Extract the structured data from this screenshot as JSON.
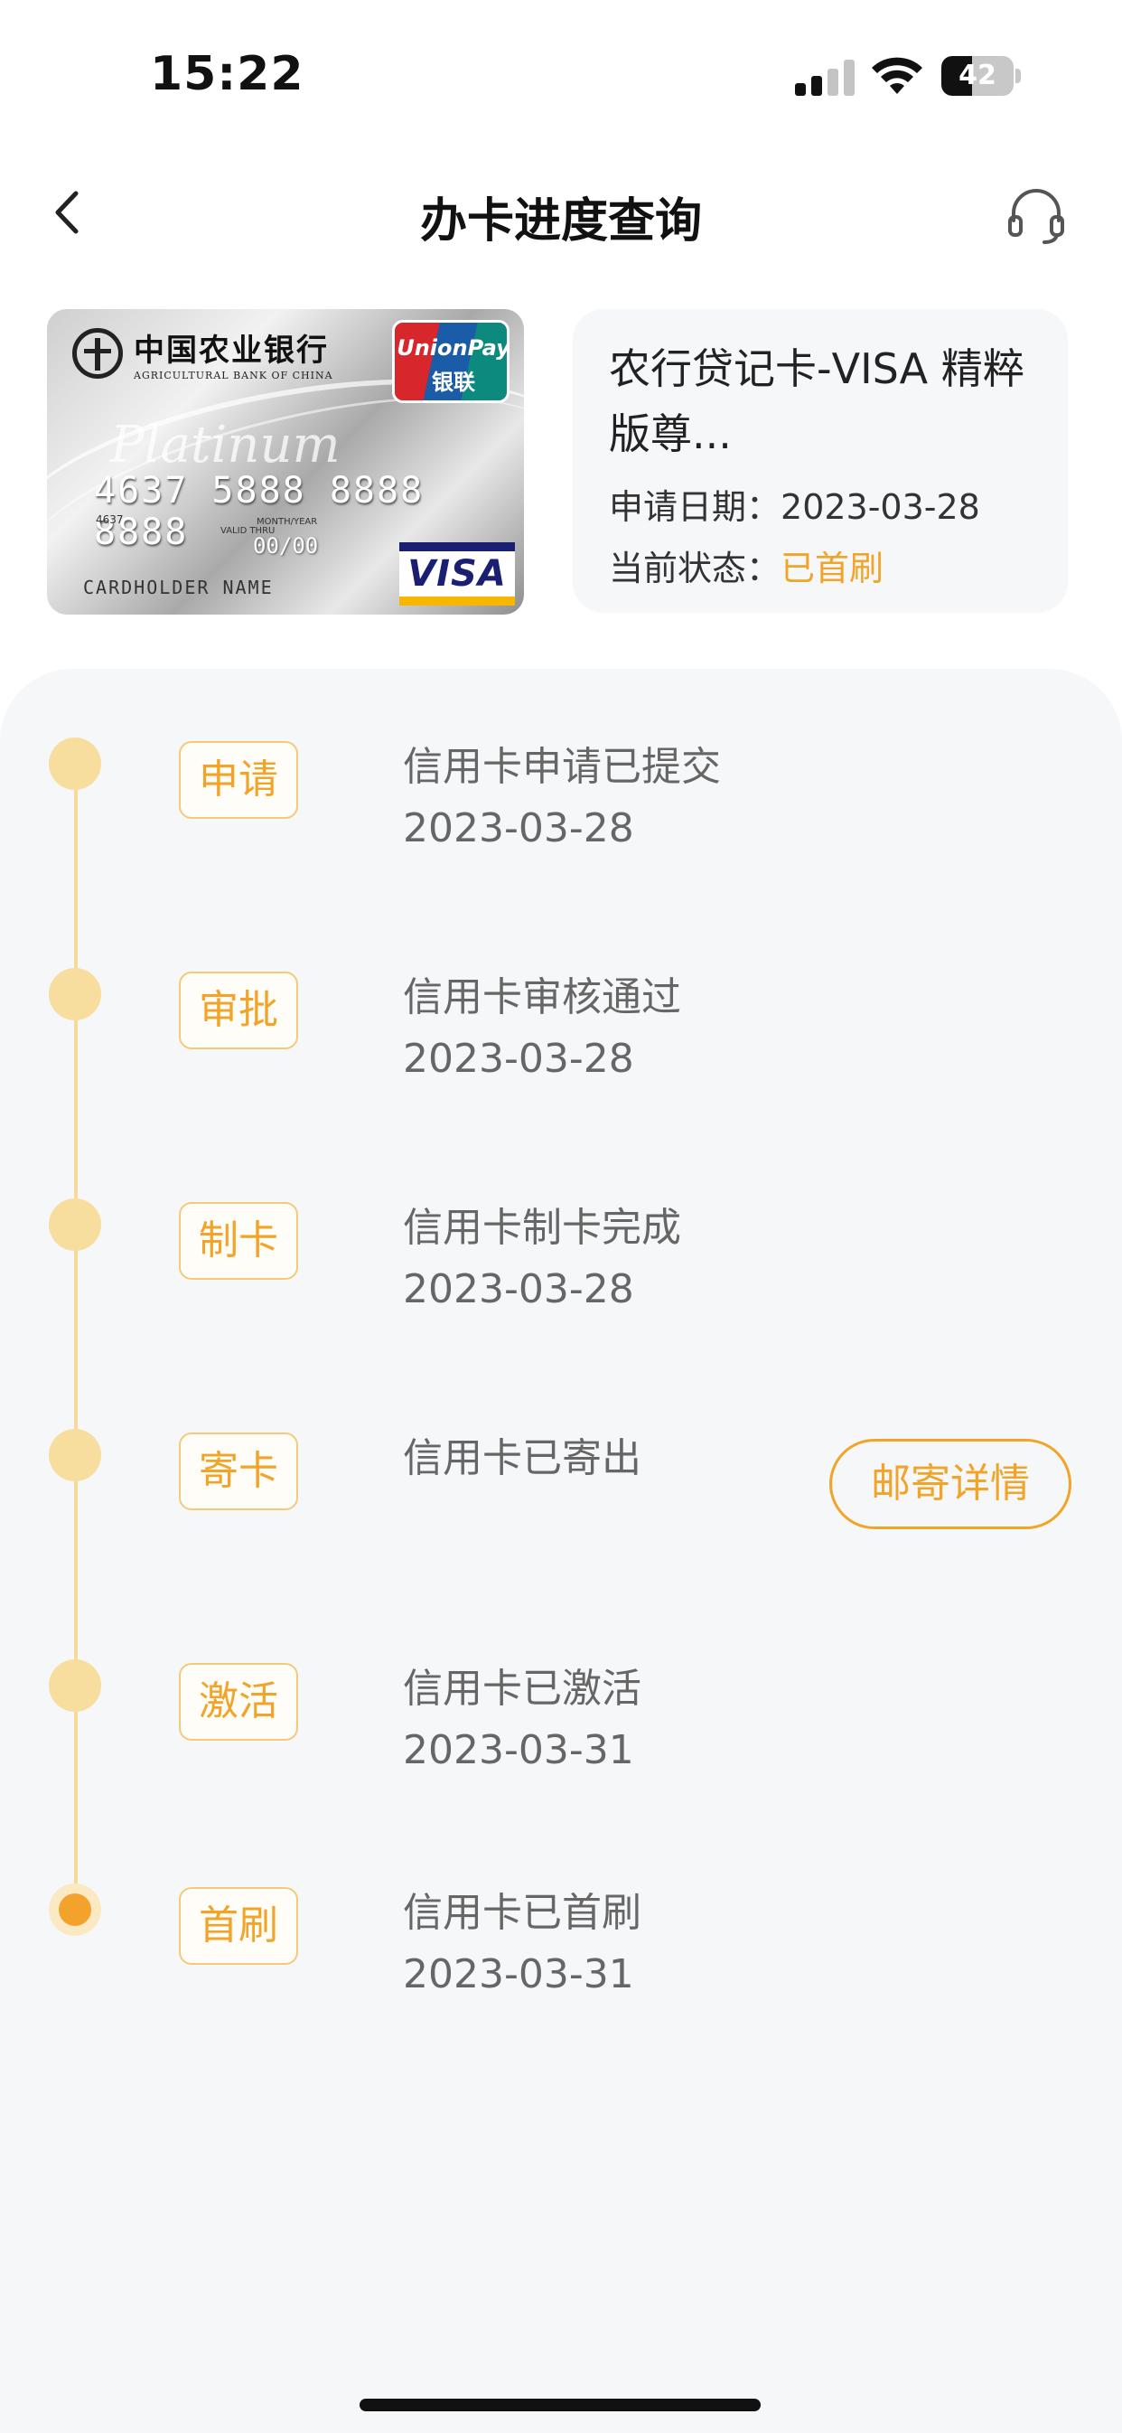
{
  "status_bar": {
    "time": "15:22",
    "battery": "42",
    "battery_level": 0.42
  },
  "nav": {
    "title": "办卡进度查询",
    "back_icon": "chevron-left-icon",
    "service_icon": "headset-icon"
  },
  "card": {
    "image": {
      "bank_name_cn": "中国农业银行",
      "bank_name_en": "AGRICULTURAL BANK OF CHINA",
      "unionpay_en": "UnionPay",
      "unionpay_cn": "银联",
      "platinum": "Platinum",
      "number": "4637 5888 8888 8888",
      "number_small": "4637",
      "valid_label": "VALID THRU",
      "month_year_label": "MONTH/YEAR",
      "expiry": "00/00",
      "holder": "CARDHOLDER NAME",
      "network": "VISA"
    },
    "name": "农行贷记卡-VISA 精粹版尊...",
    "apply_date_label": "申请日期：",
    "apply_date": "2023-03-28",
    "status_label": "当前状态：",
    "status": "已首刷"
  },
  "timeline": {
    "steps": [
      {
        "tag": "申请",
        "desc": "信用卡申请已提交",
        "date": "2023-03-28"
      },
      {
        "tag": "审批",
        "desc": "信用卡审核通过",
        "date": "2023-03-28"
      },
      {
        "tag": "制卡",
        "desc": "信用卡制卡完成",
        "date": "2023-03-28"
      },
      {
        "tag": "寄卡",
        "desc": "信用卡已寄出",
        "date": ""
      },
      {
        "tag": "激活",
        "desc": "信用卡已激活",
        "date": "2023-03-31"
      },
      {
        "tag": "首刷",
        "desc": "信用卡已首刷",
        "date": "2023-03-31"
      }
    ],
    "mail_button": "邮寄详情",
    "current_step": 5
  },
  "colors": {
    "accent": "#f2a429",
    "timeline_dot": "#f8de9e",
    "panel_bg": "#f6f7f9"
  }
}
